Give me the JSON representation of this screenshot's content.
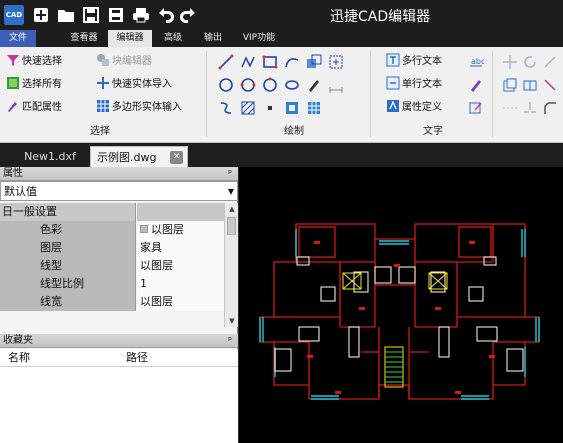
{
  "app": {
    "title": "迅捷CAD编辑器",
    "icon_text": "CAD"
  },
  "menu": [
    "文件",
    "查看器",
    "编辑器",
    "高级",
    "输出",
    "VIP功能"
  ],
  "ribbon": {
    "select": {
      "label": "选择",
      "buttons": [
        "快速选择",
        "块编辑器",
        "选择所有",
        "快速实体导入",
        "匹配属性",
        "多边形实体输入"
      ]
    },
    "draw": {
      "label": "绘制"
    },
    "text": {
      "label": "文字",
      "buttons": [
        "多行文本",
        "单行文本",
        "属性定义"
      ]
    }
  },
  "tabs": [
    "New1.dxf",
    "示例图.dwg"
  ],
  "properties": {
    "title": "属性",
    "combo_value": "默认值",
    "group": "日一般设置",
    "rows": [
      {
        "name": "色彩",
        "value": "以图层"
      },
      {
        "name": "图层",
        "value": "家具"
      },
      {
        "name": "线型",
        "value": "以图层"
      },
      {
        "name": "线型比例",
        "value": "1"
      },
      {
        "name": "线宽",
        "value": "以图层"
      }
    ]
  },
  "favorites": {
    "title": "收藏夹",
    "columns": [
      "名称",
      "路径"
    ]
  },
  "panel_pin": "ᵖ",
  "icons": {
    "new": "new-file-icon",
    "open": "open-folder-icon",
    "save": "save-icon",
    "save_as": "save-as-icon",
    "print": "print-icon",
    "undo": "undo-icon",
    "redo": "redo-icon"
  },
  "colors": {
    "accent": "#3b5fb8",
    "canvas": "#000000",
    "wall": "#d11a1a",
    "fixture": "#ffffff",
    "window": "#1fc9d9",
    "stair": "#f2e51a"
  }
}
